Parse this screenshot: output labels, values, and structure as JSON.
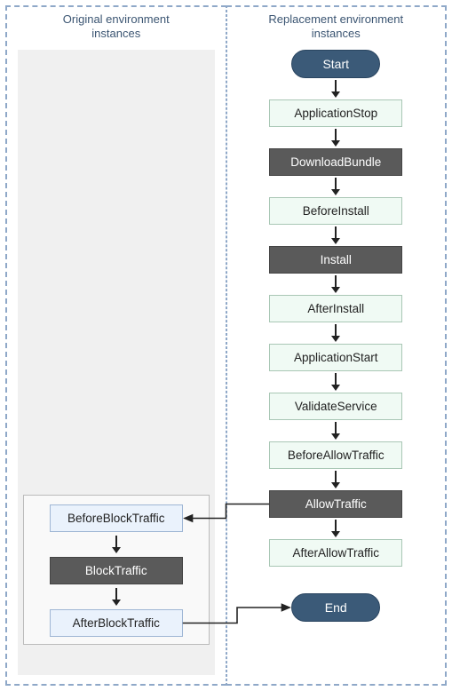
{
  "columns": {
    "left": {
      "title_line1": "Original environment",
      "title_line2": "instances"
    },
    "right": {
      "title_line1": "Replacement environment",
      "title_line2": "instances"
    }
  },
  "terminators": {
    "start": "Start",
    "end": "End"
  },
  "right_flow": [
    {
      "id": "ApplicationStop",
      "label": "ApplicationStop",
      "style": "light"
    },
    {
      "id": "DownloadBundle",
      "label": "DownloadBundle",
      "style": "dark"
    },
    {
      "id": "BeforeInstall",
      "label": "BeforeInstall",
      "style": "light"
    },
    {
      "id": "Install",
      "label": "Install",
      "style": "dark"
    },
    {
      "id": "AfterInstall",
      "label": "AfterInstall",
      "style": "light"
    },
    {
      "id": "ApplicationStart",
      "label": "ApplicationStart",
      "style": "light"
    },
    {
      "id": "ValidateService",
      "label": "ValidateService",
      "style": "light"
    },
    {
      "id": "BeforeAllowTraffic",
      "label": "BeforeAllowTraffic",
      "style": "light"
    },
    {
      "id": "AllowTraffic",
      "label": "AllowTraffic",
      "style": "dark"
    },
    {
      "id": "AfterAllowTraffic",
      "label": "AfterAllowTraffic",
      "style": "light"
    }
  ],
  "left_block_flow": [
    {
      "id": "BeforeBlockTraffic",
      "label": "BeforeBlockTraffic",
      "style": "blockstyle"
    },
    {
      "id": "BlockTraffic",
      "label": "BlockTraffic",
      "style": "dark"
    },
    {
      "id": "AfterBlockTraffic",
      "label": "AfterBlockTraffic",
      "style": "blockstyle"
    }
  ],
  "connections": [
    {
      "from": "AllowTraffic",
      "to": "BeforeBlockTraffic",
      "kind": "cross-left"
    },
    {
      "from": "AfterBlockTraffic",
      "to": "End",
      "kind": "cross-right"
    }
  ],
  "colors": {
    "dashed_border": "#8fa8c8",
    "title_text": "#3b5572",
    "node_light_bg": "#f0faf4",
    "node_dark_bg": "#5a5a5a",
    "node_block_bg": "#eaf2fc",
    "terminator_bg": "#3b5a78",
    "left_fill_bg": "#f0f0f0",
    "arrow": "#222222"
  }
}
